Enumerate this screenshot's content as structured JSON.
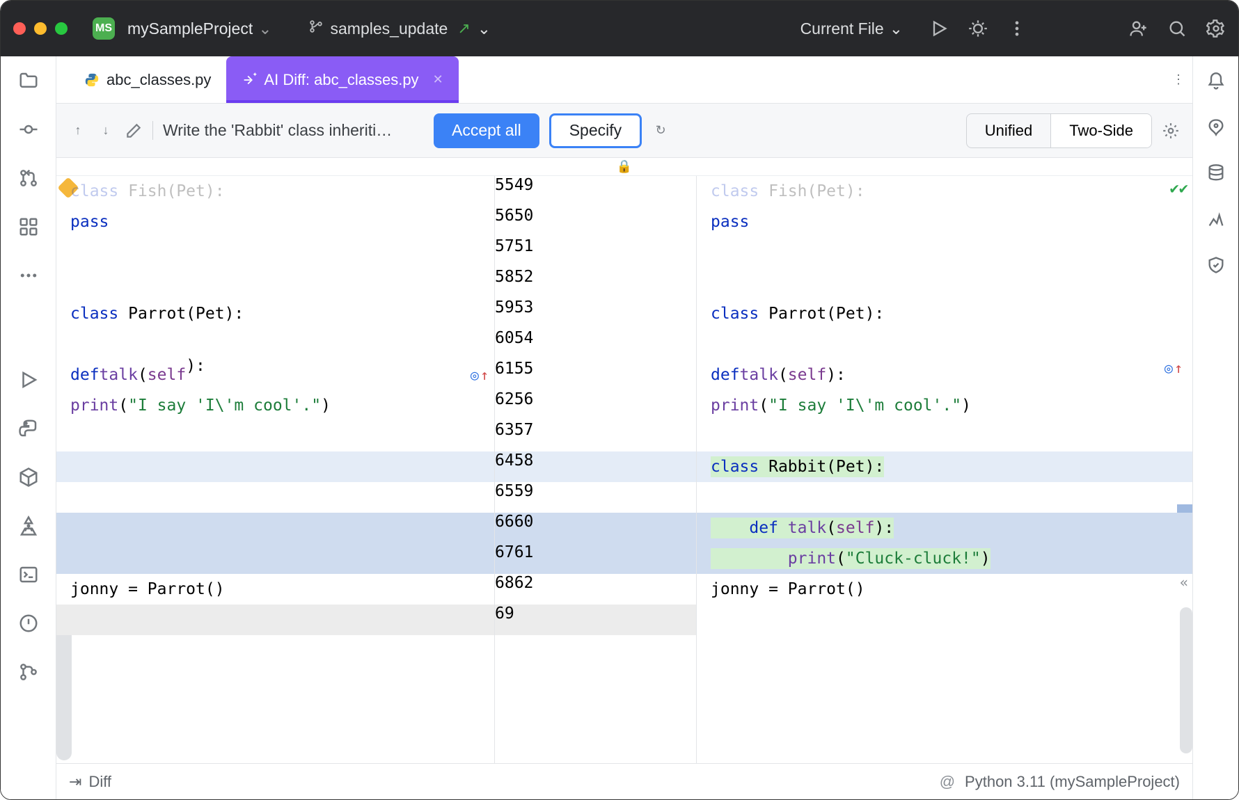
{
  "titlebar": {
    "project_badge": "MS",
    "project_name": "mySampleProject",
    "branch_name": "samples_update",
    "run_config": "Current File"
  },
  "tabs": {
    "file_tab": "abc_classes.py",
    "diff_tab": "AI Diff: abc_classes.py"
  },
  "toolbar": {
    "prompt": "Write the 'Rabbit' class inheriti…",
    "accept_label": "Accept all",
    "specify_label": "Specify",
    "view_unified": "Unified",
    "view_twoside": "Two-Side"
  },
  "left_code": {
    "l_top_partial": "class Fish(Pet):",
    "l_pass": "    pass",
    "l_parrot": "class Parrot(Pet):",
    "l_talk": "    def talk(self):",
    "l_print": "        print(\"I say 'I\\'m cool'.\")",
    "l_jonny": "jonny = Parrot()"
  },
  "right_code": {
    "r_top_partial": "class Fish(Pet):",
    "r_pass": "    pass",
    "r_parrot": "class Parrot(Pet):",
    "r_talk": "    def talk(self):",
    "r_print": "        print(\"I say 'I\\'m cool'.\")",
    "r_rabbit": "class Rabbit(Pet):",
    "r_talk2": "    def talk(self):",
    "r_print2": "        print(\"Cluck-cluck!\")",
    "r_jonny": "jonny = Parrot()"
  },
  "gutter": {
    "left_nums": [
      "55",
      "56",
      "57",
      "58",
      "59",
      "60",
      "61",
      "62",
      "63",
      "64",
      "65",
      "66",
      "67",
      "68",
      "69"
    ],
    "right_nums": [
      "49",
      "50",
      "51",
      "52",
      "53",
      "54",
      "55",
      "56",
      "57",
      "58",
      "59",
      "60",
      "61",
      "62",
      ""
    ]
  },
  "statusbar": {
    "left": "Diff",
    "right": "Python 3.11 (mySampleProject)"
  }
}
